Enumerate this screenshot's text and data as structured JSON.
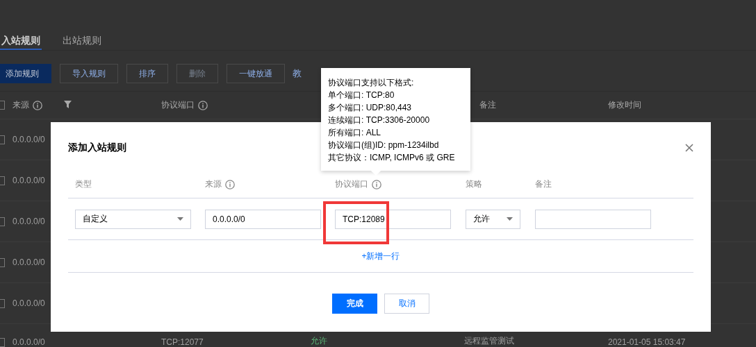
{
  "page": {
    "tabs": [
      {
        "label": "入站规则",
        "selected": true
      },
      {
        "label": "出站规则",
        "selected": false
      }
    ],
    "toolbar": [
      {
        "label": "添加规则",
        "kind": "primary",
        "disabled": false
      },
      {
        "label": "导入规则",
        "kind": "default",
        "disabled": false
      },
      {
        "label": "排序",
        "kind": "default",
        "disabled": false
      },
      {
        "label": "删除",
        "kind": "default",
        "disabled": true
      },
      {
        "label": "一键放通",
        "kind": "default",
        "disabled": false
      },
      {
        "label": "教",
        "kind": "link",
        "disabled": false
      }
    ],
    "table": {
      "select_all_checked": false,
      "columns": [
        {
          "label": "来源",
          "info": true
        },
        {
          "label": "协议端口",
          "info": true
        },
        {
          "label": "备注",
          "info": false
        },
        {
          "label": "修改时间",
          "info": false
        }
      ],
      "rows": [
        {
          "checked": false,
          "source": "0.0.0.0/0"
        },
        {
          "checked": false,
          "source": "0.0.0.0/0"
        },
        {
          "checked": false,
          "source": "0.0.0.0/0"
        },
        {
          "checked": false,
          "source": "0.0.0.0/0"
        },
        {
          "checked": false,
          "source": "0.0.0.0/0"
        },
        {
          "checked": false,
          "source": "0.0.0.0/0",
          "port": "TCP:12077",
          "policy": "允许",
          "remark": "远程监管测试",
          "time": "2021-01-05 15:03:47"
        }
      ]
    }
  },
  "tooltip": {
    "lines": [
      "协议端口支持以下格式:",
      "单个端口: TCP:80",
      "多个端口: UDP:80,443",
      "连续端口: TCP:3306-20000",
      "所有端口: ALL",
      "协议端口(组)ID: ppm-1234ilbd",
      "其它协议：ICMP, ICMPv6 或 GRE"
    ]
  },
  "modal": {
    "title": "添加入站规则",
    "columns": [
      {
        "label": "类型",
        "info": false
      },
      {
        "label": "来源",
        "info": true
      },
      {
        "label": "协议端口",
        "info": true
      },
      {
        "label": "策略",
        "info": false
      },
      {
        "label": "备注",
        "info": false
      }
    ],
    "fields": [
      {
        "kind": "select",
        "value": "自定义"
      },
      {
        "kind": "input",
        "value": "0.0.0.0/0"
      },
      {
        "kind": "input",
        "value": "TCP:12089",
        "highlighted": true
      },
      {
        "kind": "select",
        "value": "允许"
      },
      {
        "kind": "input"
      }
    ],
    "add_row": "+新增一行",
    "buttons": [
      {
        "label": "完成",
        "kind": "primary"
      },
      {
        "label": "取消",
        "kind": "default"
      }
    ]
  }
}
